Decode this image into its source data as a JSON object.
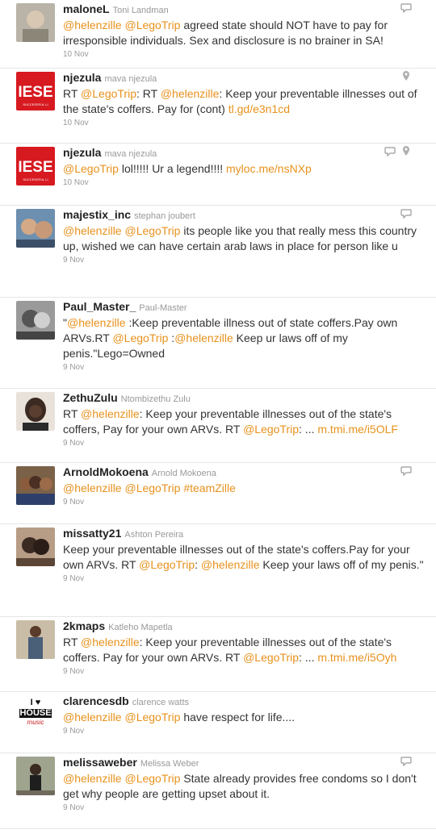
{
  "tweets": [
    {
      "screen": "maloneL",
      "full": "Toni Landman",
      "time": "10 Nov",
      "parts": [
        [
          "@helenzille",
          1
        ],
        [
          " ",
          0
        ],
        [
          "@LegoTrip",
          1
        ],
        [
          " agreed state should NOT have to pay for irresponsible individuals. Sex and disclosure is no brainer in SA!",
          0
        ]
      ],
      "icons": [
        "reply-icon"
      ],
      "avatar": "photo-grey"
    },
    {
      "screen": "njezula",
      "full": "mava njezula",
      "time": "10 Nov",
      "parts": [
        [
          "RT ",
          0
        ],
        [
          "@LegoTrip",
          1
        ],
        [
          ": RT ",
          0
        ],
        [
          "@helenzille",
          1
        ],
        [
          ": Keep your preventable illnesses out of the state's coffers. Pay for (cont) ",
          0
        ],
        [
          "tl.gd/e3n1cd",
          1
        ]
      ],
      "icons": [
        "location-icon"
      ],
      "avatar": "iese-logo"
    },
    {
      "screen": "njezula",
      "full": "mava njezula",
      "time": "10 Nov",
      "parts": [
        [
          "@LegoTrip",
          1
        ],
        [
          " lol!!!!! Ur a legend!!!! ",
          0
        ],
        [
          "myloc.me/nsNXp",
          1
        ]
      ],
      "icons": [
        "reply-icon",
        "location-icon"
      ],
      "avatar": "iese-logo"
    },
    {
      "screen": "majestix_inc",
      "full": "stephan joubert",
      "time": "9 Nov",
      "parts": [
        [
          "@helenzille",
          1
        ],
        [
          " ",
          0
        ],
        [
          "@LegoTrip",
          1
        ],
        [
          " its people like you that really mess this country up, wished we can have certain arab laws in place for person like u",
          0
        ]
      ],
      "icons": [
        "reply-icon"
      ],
      "avatar": "photo-blue"
    },
    {
      "screen": "Paul_Master_",
      "full": "Paul-Master",
      "time": "9 Nov",
      "parts": [
        [
          "\"",
          0
        ],
        [
          "@helenzille",
          1
        ],
        [
          " :Keep preventable illness out of state coffers.Pay own ARVs.RT ",
          0
        ],
        [
          "@LegoTrip",
          1
        ],
        [
          " :",
          0
        ],
        [
          "@helenzille",
          1
        ],
        [
          " Keep ur laws off of my penis.\"Lego=Owned",
          0
        ]
      ],
      "icons": [],
      "avatar": "photo-bw"
    },
    {
      "screen": "ZethuZulu",
      "full": "Ntombizethu Zulu",
      "time": "9 Nov",
      "parts": [
        [
          "RT ",
          0
        ],
        [
          "@helenzille",
          1
        ],
        [
          ": Keep your preventable illnesses out of the state's coffers, Pay for your own ARVs. RT ",
          0
        ],
        [
          "@LegoTrip",
          1
        ],
        [
          ": ... ",
          0
        ],
        [
          "m.tmi.me/i5OLF",
          1
        ]
      ],
      "icons": [],
      "avatar": "photo-dark"
    },
    {
      "screen": "ArnoldMokoena",
      "full": "Arnold Mokoena",
      "time": "9 Nov",
      "parts": [
        [
          "@helenzille",
          1
        ],
        [
          " ",
          0
        ],
        [
          "@LegoTrip",
          1
        ],
        [
          " ",
          0
        ],
        [
          "#teamZille",
          1
        ]
      ],
      "icons": [
        "reply-icon"
      ],
      "avatar": "photo-group"
    },
    {
      "screen": "missatty21",
      "full": "Ashton Pereira",
      "time": "9 Nov",
      "parts": [
        [
          "Keep your preventable illnesses out of the state's coffers.Pay for your own ARVs. RT ",
          0
        ],
        [
          "@LegoTrip",
          1
        ],
        [
          ": ",
          0
        ],
        [
          "@helenzille",
          1
        ],
        [
          " Keep your laws off of my penis.\"",
          0
        ]
      ],
      "icons": [],
      "avatar": "photo-pair"
    },
    {
      "screen": "2kmaps",
      "full": "Katleho Mapetla",
      "time": "9 Nov",
      "parts": [
        [
          "RT ",
          0
        ],
        [
          "@helenzille",
          1
        ],
        [
          ": Keep your preventable illnesses out of the state's coffers. Pay for your own ARVs. RT ",
          0
        ],
        [
          "@LegoTrip",
          1
        ],
        [
          ": ... ",
          0
        ],
        [
          "m.tmi.me/i5Oyh",
          1
        ]
      ],
      "icons": [],
      "avatar": "photo-man"
    },
    {
      "screen": "clarencesdb",
      "full": "clarence watts",
      "time": "9 Nov",
      "parts": [
        [
          "@helenzille",
          1
        ],
        [
          " ",
          0
        ],
        [
          "@LegoTrip",
          1
        ],
        [
          " have respect for life....",
          0
        ]
      ],
      "icons": [],
      "avatar": "house-logo",
      "avatar_text": [
        "I",
        "HOUSE",
        "music"
      ]
    },
    {
      "screen": "melissaweber",
      "full": "Melissa Weber",
      "time": "9 Nov",
      "parts": [
        [
          "@helenzille",
          1
        ],
        [
          " ",
          0
        ],
        [
          "@LegoTrip",
          1
        ],
        [
          " State already provides free condoms so I don't get why people are getting upset about it.",
          0
        ]
      ],
      "icons": [
        "reply-icon"
      ],
      "avatar": "photo-street"
    }
  ],
  "logo_text": {
    "iese": "IESE",
    "iese_sub": "SUCCESSFUL LI"
  },
  "colors": {
    "mention": "#e8911c",
    "iese_red": "#d71920"
  }
}
